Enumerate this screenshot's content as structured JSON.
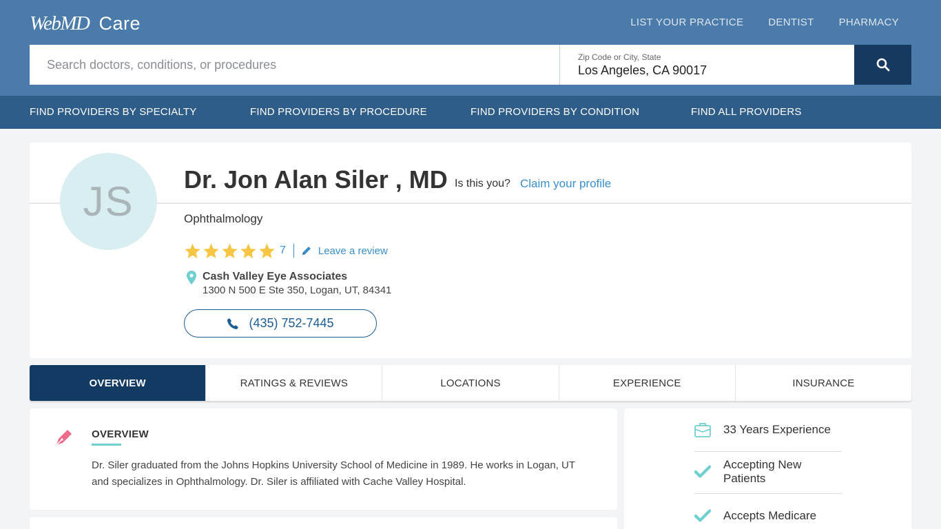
{
  "header": {
    "logo_brand": "WebMD",
    "logo_care": "Care",
    "top_links": [
      "LIST YOUR PRACTICE",
      "DENTIST",
      "PHARMACY"
    ]
  },
  "search": {
    "placeholder": "Search doctors, conditions, or procedures",
    "location_label": "Zip Code or City, State",
    "location_value": "Los Angeles, CA 90017",
    "icon": "search-icon"
  },
  "nav": {
    "items": [
      "FIND PROVIDERS BY SPECIALTY",
      "FIND PROVIDERS BY PROCEDURE",
      "FIND PROVIDERS BY CONDITION",
      "FIND ALL PROVIDERS"
    ]
  },
  "profile": {
    "initials": "JS",
    "name": "Dr. Jon Alan Siler , MD",
    "is_this_you": "Is this you?",
    "claim_link": "Claim your profile",
    "specialty": "Ophthalmology",
    "rating_stars": 5,
    "rating_count": "7",
    "leave_review": "Leave a review",
    "practice_name": "Cash Valley Eye Associates",
    "practice_address": "1300 N 500 E Ste 350, Logan, UT, 84341",
    "phone": "(435) 752-7445"
  },
  "tabs": [
    {
      "label": "OVERVIEW",
      "active": true
    },
    {
      "label": "RATINGS & REVIEWS",
      "active": false
    },
    {
      "label": "LOCATIONS",
      "active": false
    },
    {
      "label": "EXPERIENCE",
      "active": false
    },
    {
      "label": "INSURANCE",
      "active": false
    }
  ],
  "overview": {
    "title": "OVERVIEW",
    "text": "Dr. Siler graduated from the Johns Hopkins University School of Medicine in 1989. He works in Logan, UT and specializes in Ophthalmology. Dr. Siler is affiliated with Cache Valley Hospital."
  },
  "facts": [
    {
      "icon": "briefcase-icon",
      "text": "33 Years Experience"
    },
    {
      "icon": "checkmark-icon",
      "text": "Accepting New Patients"
    },
    {
      "icon": "checkmark-icon",
      "text": "Accepts Medicare"
    }
  ],
  "colors": {
    "header_bg": "#4a7baa",
    "nav_bg": "#2f5d8a",
    "accent_dark": "#123a62",
    "link_blue": "#3b8ec9",
    "teal": "#6ecfd1",
    "star_yellow": "#f6c543",
    "pink": "#ef6a8a"
  }
}
